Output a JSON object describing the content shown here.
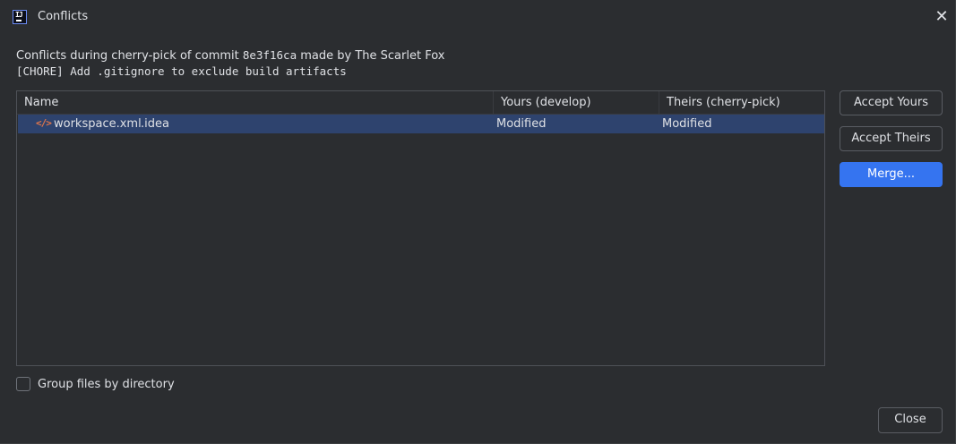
{
  "window": {
    "title": "Conflicts",
    "app_icon": "intellij-icon",
    "close_icon": "close-icon"
  },
  "description": {
    "line1_prefix": "Conflicts during cherry-pick of commit ",
    "commit_hash": "8e3f16ca",
    "line1_suffix": " made by The Scarlet Fox",
    "line2": "[CHORE] Add .gitignore to exclude build artifacts"
  },
  "table": {
    "columns": [
      "Name",
      "Yours (develop)",
      "Theirs (cherry-pick)"
    ],
    "rows": [
      {
        "icon": "xml-file-icon",
        "name": "workspace.xml",
        "path": ".idea",
        "yours": "Modified",
        "theirs": "Modified",
        "selected": true
      }
    ]
  },
  "actions": {
    "accept_yours": "Accept Yours",
    "accept_theirs": "Accept Theirs",
    "merge": "Merge..."
  },
  "options": {
    "group_by_directory_label": "Group files by directory",
    "group_by_directory_checked": false
  },
  "footer": {
    "close_label": "Close"
  },
  "colors": {
    "background": "#2b2d30",
    "selection": "#2e436e",
    "primary_button": "#3574f0",
    "xml_icon": "#e2764a"
  }
}
